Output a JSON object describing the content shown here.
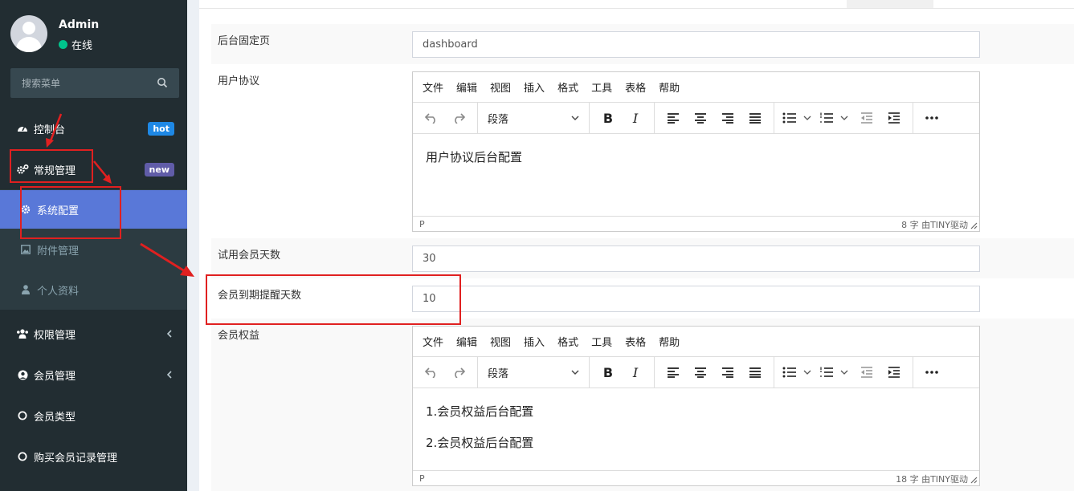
{
  "sidebar": {
    "user": {
      "name": "Admin",
      "status": "在线"
    },
    "search": {
      "placeholder": "搜索菜单"
    },
    "items": [
      {
        "label": "控制台",
        "badge": "hot"
      },
      {
        "label": "常规管理",
        "badge": "new"
      },
      {
        "label": "系统配置"
      },
      {
        "label": "附件管理"
      },
      {
        "label": "个人资料"
      },
      {
        "label": "权限管理"
      },
      {
        "label": "会员管理"
      },
      {
        "label": "会员类型"
      },
      {
        "label": "购买会员记录管理"
      }
    ]
  },
  "form": {
    "fixed_page": {
      "label": "后台固定页",
      "value": "dashboard"
    },
    "user_agreement": {
      "label": "用户协议",
      "content": [
        "用户协议后台配置"
      ],
      "status_left": "P",
      "status_right": "8 字  由TINY驱动"
    },
    "trial_days": {
      "label": "试用会员天数",
      "value": "30"
    },
    "expire_remind_days": {
      "label": "会员到期提醒天数",
      "value": "10"
    },
    "member_rights": {
      "label": "会员权益",
      "content": [
        "1.会员权益后台配置",
        "2.会员权益后台配置"
      ],
      "status_left": "P",
      "status_right": "18 字  由TINY驱动"
    }
  },
  "editor": {
    "menubar": [
      "文件",
      "编辑",
      "视图",
      "插入",
      "格式",
      "工具",
      "表格",
      "帮助"
    ],
    "block_format": "段落"
  },
  "colors": {
    "sidebar_bg": "#222d32",
    "active_item": "#5978d8",
    "annotation_red": "#e02020"
  }
}
